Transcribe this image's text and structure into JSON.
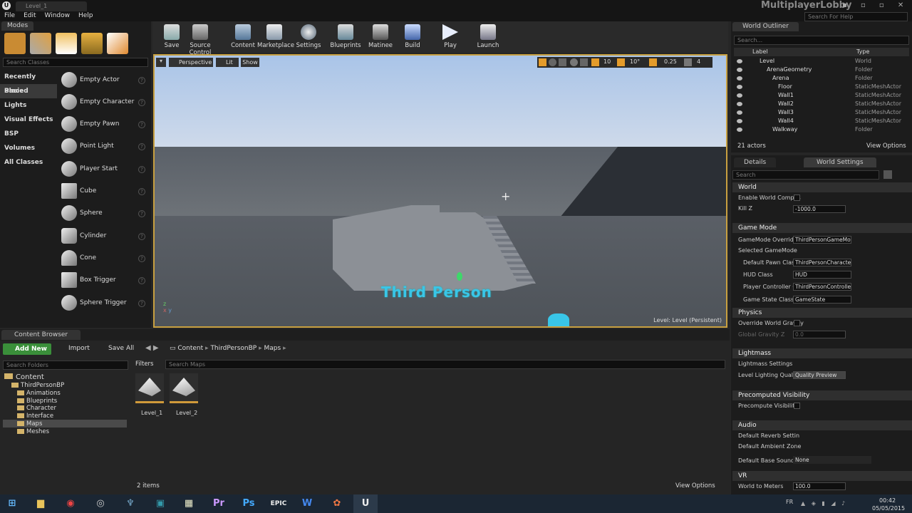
{
  "window": {
    "tab_title": "Level_1",
    "project_name": "MultiplayerLobby",
    "search_help_placeholder": "Search For Help"
  },
  "menu": [
    "File",
    "Edit",
    "Window",
    "Help"
  ],
  "modes": {
    "tab": "Modes",
    "search_placeholder": "Search Classes",
    "categories": [
      "Recently Placed",
      "Basic",
      "Lights",
      "Visual Effects",
      "BSP",
      "Volumes",
      "All Classes"
    ],
    "items": [
      "Empty Actor",
      "Empty Character",
      "Empty Pawn",
      "Point Light",
      "Player Start",
      "Cube",
      "Sphere",
      "Cylinder",
      "Cone",
      "Box Trigger",
      "Sphere Trigger"
    ]
  },
  "toolbar": [
    "Save",
    "Source Control",
    "Content",
    "Marketplace",
    "Settings",
    "Blueprints",
    "Matinee",
    "Build",
    "Play",
    "Launch"
  ],
  "viewport": {
    "perspective": "Perspective",
    "lit": "Lit",
    "show": "Show",
    "grid_snap": "10",
    "rot_snap": "10°",
    "scale_snap": "0.25",
    "cam_speed": "4",
    "level_label": "Level:  Level (Persistent)",
    "scene_text": "Third Person"
  },
  "outliner": {
    "tab": "World Outliner",
    "search_placeholder": "Search...",
    "col_label": "Label",
    "col_type": "Type",
    "rows": [
      {
        "label": "Level",
        "type": "World"
      },
      {
        "label": "ArenaGeometry",
        "type": "Folder"
      },
      {
        "label": "Arena",
        "type": "Folder"
      },
      {
        "label": "Floor",
        "type": "StaticMeshActor"
      },
      {
        "label": "Wall1",
        "type": "StaticMeshActor"
      },
      {
        "label": "Wall2",
        "type": "StaticMeshActor"
      },
      {
        "label": "Wall3",
        "type": "StaticMeshActor"
      },
      {
        "label": "Wall4",
        "type": "StaticMeshActor"
      },
      {
        "label": "Walkway",
        "type": "Folder"
      }
    ],
    "actor_count": "21 actors",
    "view_options": "View Options"
  },
  "details": {
    "tab_details": "Details",
    "tab_world_settings": "World Settings",
    "search_placeholder": "Search",
    "world": "World",
    "enable_world_compos": "Enable World Compos",
    "kill_z_label": "Kill Z",
    "kill_z_value": "-1000.0",
    "game_mode": "Game Mode",
    "gamemode_override": "GameMode Override",
    "gamemode_override_value": "ThirdPersonGameMo",
    "selected_gamemode": "Selected GameMode",
    "default_pawn_label": "Default Pawn Class",
    "default_pawn_value": "ThirdPersonCharacte",
    "hud_label": "HUD Class",
    "hud_value": "HUD",
    "player_controller_label": "Player Controller Cl",
    "player_controller_value": "ThirdPersonControlle",
    "game_state_label": "Game State Class",
    "game_state_value": "GameState",
    "physics": "Physics",
    "override_gravity": "Override World Gravity",
    "global_gravity_label": "Global Gravity Z",
    "global_gravity_value": "0.0",
    "lightmass": "Lightmass",
    "lightmass_settings": "Lightmass Settings",
    "level_lighting_label": "Level Lighting Quality",
    "level_lighting_value": "Quality Preview",
    "precomputed": "Precomputed Visibility",
    "precompute_vis": "Precompute Visibility",
    "audio": "Audio",
    "default_reverb": "Default Reverb Settin",
    "default_ambient": "Default Ambient Zone",
    "default_base_sound": "Default Base Sound M",
    "default_base_sound_value": "None",
    "vr": "VR",
    "world_to_meters": "World to Meters",
    "world_to_meters_value": "100.0"
  },
  "content_browser": {
    "tab": "Content Browser",
    "add_new": "Add New",
    "import": "Import",
    "save_all": "Save All",
    "breadcrumb": [
      "Content",
      "ThirdPersonBP",
      "Maps"
    ],
    "search_folders": "Search Folders",
    "filters": "Filters",
    "search_maps": "Search Maps",
    "tree_root": "Content",
    "tree_sub": "ThirdPersonBP",
    "tree_children": [
      "Animations",
      "Blueprints",
      "Character",
      "Interface",
      "Maps",
      "Meshes"
    ],
    "assets": [
      "Level_1",
      "Level_2"
    ],
    "item_count": "2 items",
    "view_options": "View Options"
  },
  "taskbar": {
    "lang": "FR",
    "time": "00:42",
    "date": "05/05/2015"
  }
}
